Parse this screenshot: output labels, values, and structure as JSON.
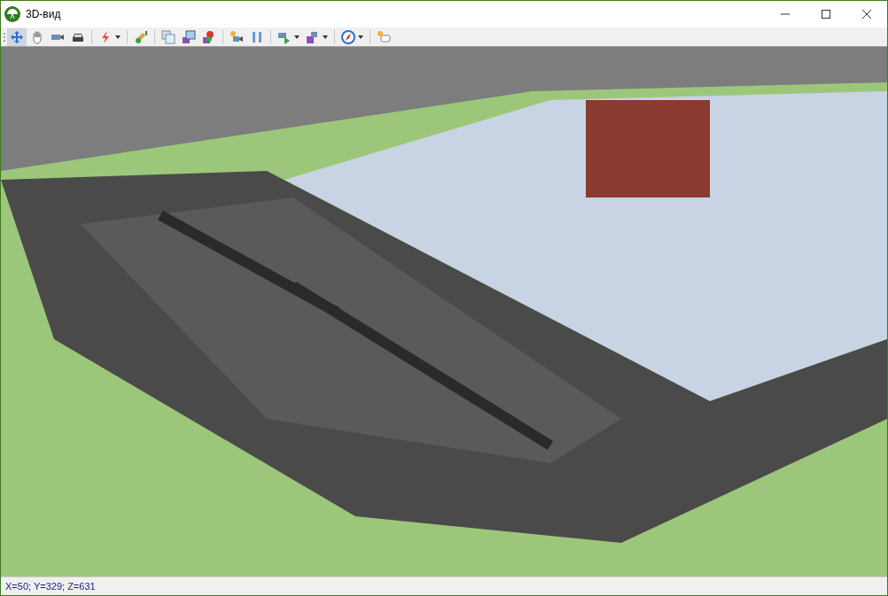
{
  "window": {
    "title": "3D-вид"
  },
  "toolbar": [
    {
      "kind": "button",
      "selected": true,
      "has_menu": false
    },
    {
      "kind": "button",
      "selected": false,
      "has_menu": false
    },
    {
      "kind": "button",
      "selected": false,
      "has_menu": false
    },
    {
      "kind": "button",
      "selected": false,
      "has_menu": false
    },
    {
      "kind": "separator"
    },
    {
      "kind": "button",
      "selected": false,
      "has_menu": true
    },
    {
      "kind": "separator"
    },
    {
      "kind": "button",
      "selected": false,
      "has_menu": false
    },
    {
      "kind": "separator"
    },
    {
      "kind": "button",
      "selected": false,
      "has_menu": false
    },
    {
      "kind": "button",
      "selected": false,
      "has_menu": false
    },
    {
      "kind": "button",
      "selected": false,
      "has_menu": false
    },
    {
      "kind": "separator"
    },
    {
      "kind": "button",
      "selected": false,
      "has_menu": false
    },
    {
      "kind": "button",
      "selected": false,
      "has_menu": false
    },
    {
      "kind": "separator"
    },
    {
      "kind": "button",
      "selected": false,
      "has_menu": true
    },
    {
      "kind": "button",
      "selected": false,
      "has_menu": true
    },
    {
      "kind": "separator"
    },
    {
      "kind": "button",
      "selected": false,
      "has_menu": true
    },
    {
      "kind": "separator"
    },
    {
      "kind": "button",
      "selected": false,
      "has_menu": false
    }
  ],
  "status_bar": {
    "coordinates": "X=50; Y=329; Z=631"
  }
}
